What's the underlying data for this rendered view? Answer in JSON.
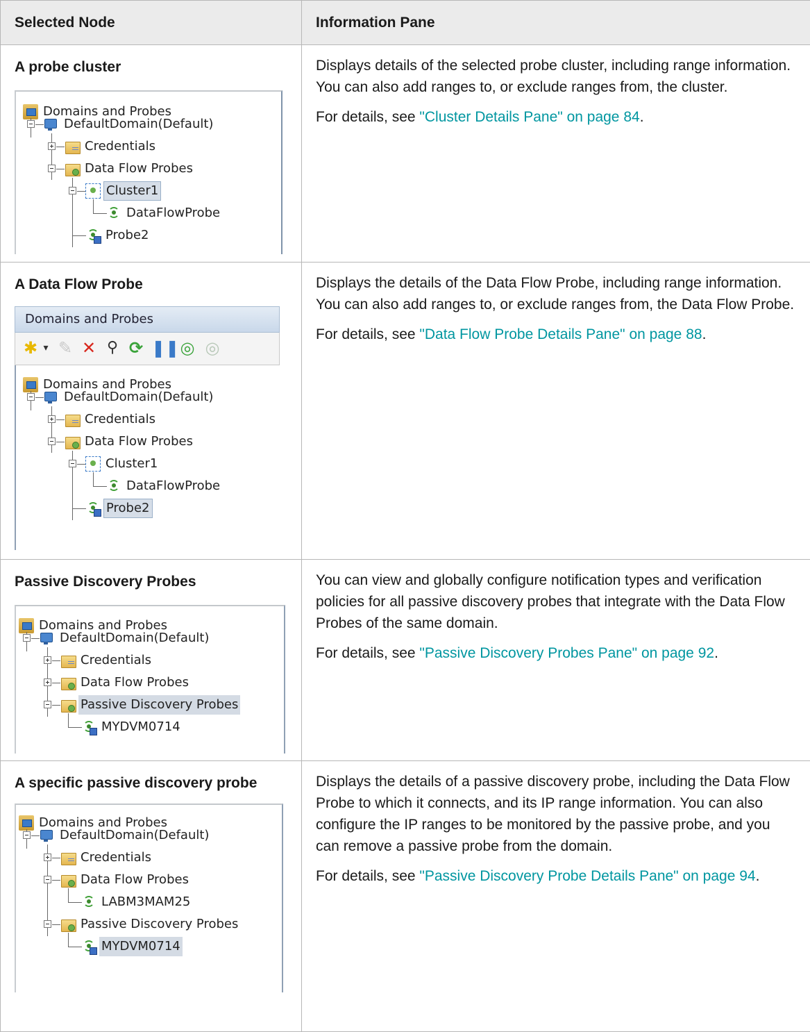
{
  "table": {
    "headers": [
      "Selected Node",
      "Information Pane"
    ],
    "rows": [
      {
        "node": "A probe cluster",
        "description": "Displays details of the selected probe cluster, including range information. You can also add ranges to, or exclude ranges from, the cluster.",
        "details_prefix": "For details, see ",
        "details_link": "\"Cluster Details Pane\" on page 84",
        "details_suffix": "."
      },
      {
        "node": "A Data Flow Probe",
        "description": "Displays the details of the Data Flow Probe, including range information. You can also add ranges to, or exclude ranges from, the Data Flow Probe.",
        "details_prefix": "For details, see ",
        "details_link": "\"Data Flow Probe Details Pane\" on page 88",
        "details_suffix": "."
      },
      {
        "node": "Passive Discovery Probes",
        "description": "You can view and globally configure notification types and verification policies for all passive discovery probes that integrate with the Data Flow Probes of the same domain.",
        "details_prefix": "For details, see ",
        "details_link": "\"Passive Discovery Probes Pane\" on page 92",
        "details_suffix": "."
      },
      {
        "node": "A specific passive discovery probe",
        "description": "Displays the details of a passive discovery probe, including the Data Flow Probe to which it connects, and its IP range information. You can also configure the IP ranges to be monitored by the passive probe, and you can remove a passive probe from the domain.",
        "details_prefix": "For details, see ",
        "details_link": "\"Passive Discovery Probe Details Pane\" on page 94",
        "details_suffix": "."
      }
    ]
  },
  "tree": {
    "root": "Domains and Probes",
    "domain": "DefaultDomain(Default)",
    "credentials": "Credentials",
    "dfp_folder": "Data Flow Probes",
    "cluster": "Cluster1",
    "dfp": "DataFlowProbe",
    "probe2": "Probe2",
    "passive_folder": "Passive Discovery Probes",
    "passive_folder_clipped": "Passive Discovery Probes",
    "passive_probe": "MYDVM0714",
    "labm": "LABM3MAM25"
  },
  "pane_header": "Domains and Probes",
  "toolbar_icons": [
    "new-icon",
    "edit-icon",
    "delete-icon",
    "search-icon",
    "refresh-icon",
    "pause-icon",
    "probe-add-icon",
    "probe-disabled-icon"
  ]
}
